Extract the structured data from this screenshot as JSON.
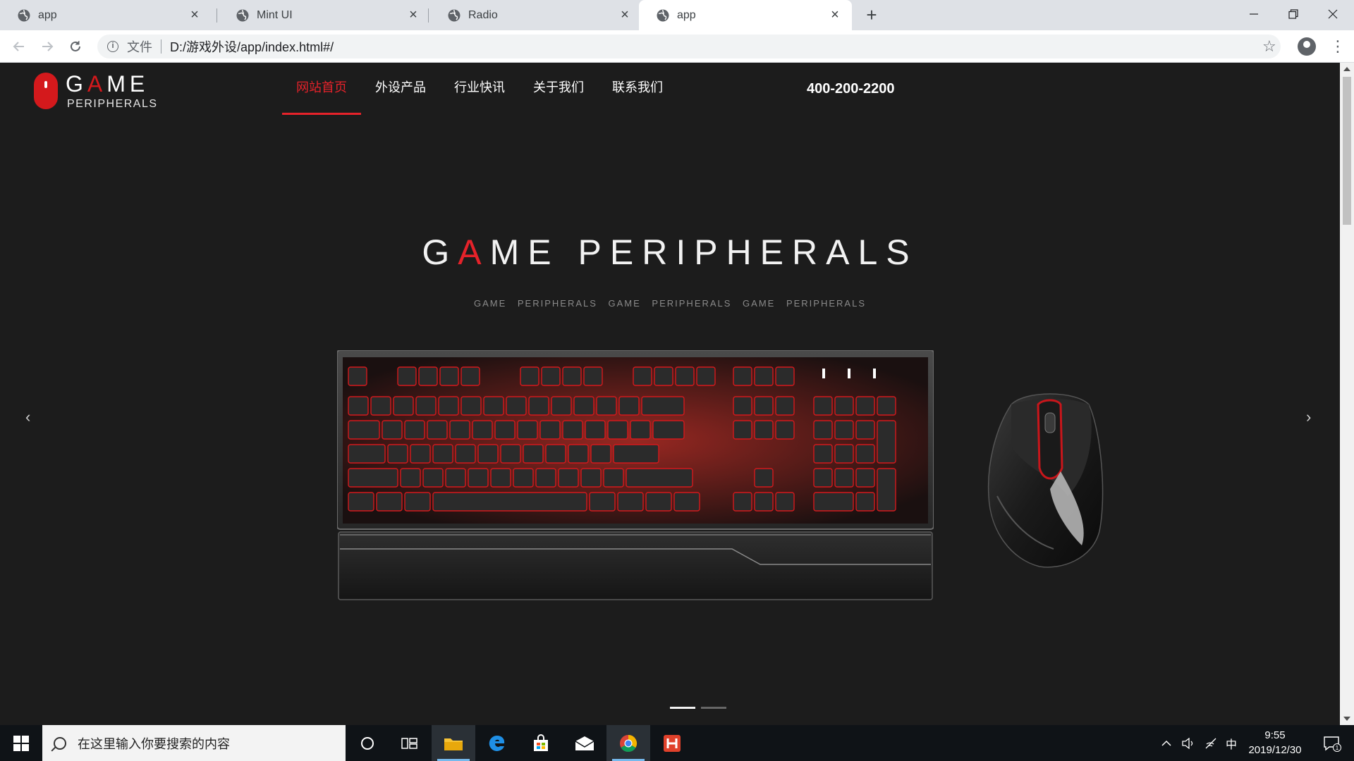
{
  "browser": {
    "tabs": [
      {
        "title": "app",
        "active": false
      },
      {
        "title": "Mint UI",
        "active": false
      },
      {
        "title": "Radio",
        "active": false
      },
      {
        "title": "app",
        "active": true
      }
    ],
    "address": {
      "scheme_label": "文件",
      "url": "D:/游戏外设/app/index.html#/"
    }
  },
  "site": {
    "logo": {
      "top_prefix": "G",
      "top_highlight": "A",
      "top_suffix": "ME",
      "bottom": "PERIPHERALS"
    },
    "nav": [
      {
        "label": "网站首页",
        "active": true
      },
      {
        "label": "外设产品",
        "active": false
      },
      {
        "label": "行业快讯",
        "active": false
      },
      {
        "label": "关于我们",
        "active": false
      },
      {
        "label": "联系我们",
        "active": false
      }
    ],
    "phone": "400-200-2200",
    "hero": {
      "title_prefix": "G",
      "title_highlight": "A",
      "title_suffix": "ME PERIPHERALS",
      "subtitle": "GAME PERIPHERALS GAME PERIPHERALS GAME PERIPHERALS",
      "prev_icon": "‹",
      "next_icon": "›",
      "slide_count": 2,
      "active_slide": 1
    }
  },
  "taskbar": {
    "search_placeholder": "在这里输入你要搜索的内容",
    "ime": "中",
    "time": "9:55",
    "date": "2019/12/30",
    "notification_count": "1"
  },
  "colors": {
    "accent": "#e5222a",
    "background": "#1c1c1c"
  }
}
